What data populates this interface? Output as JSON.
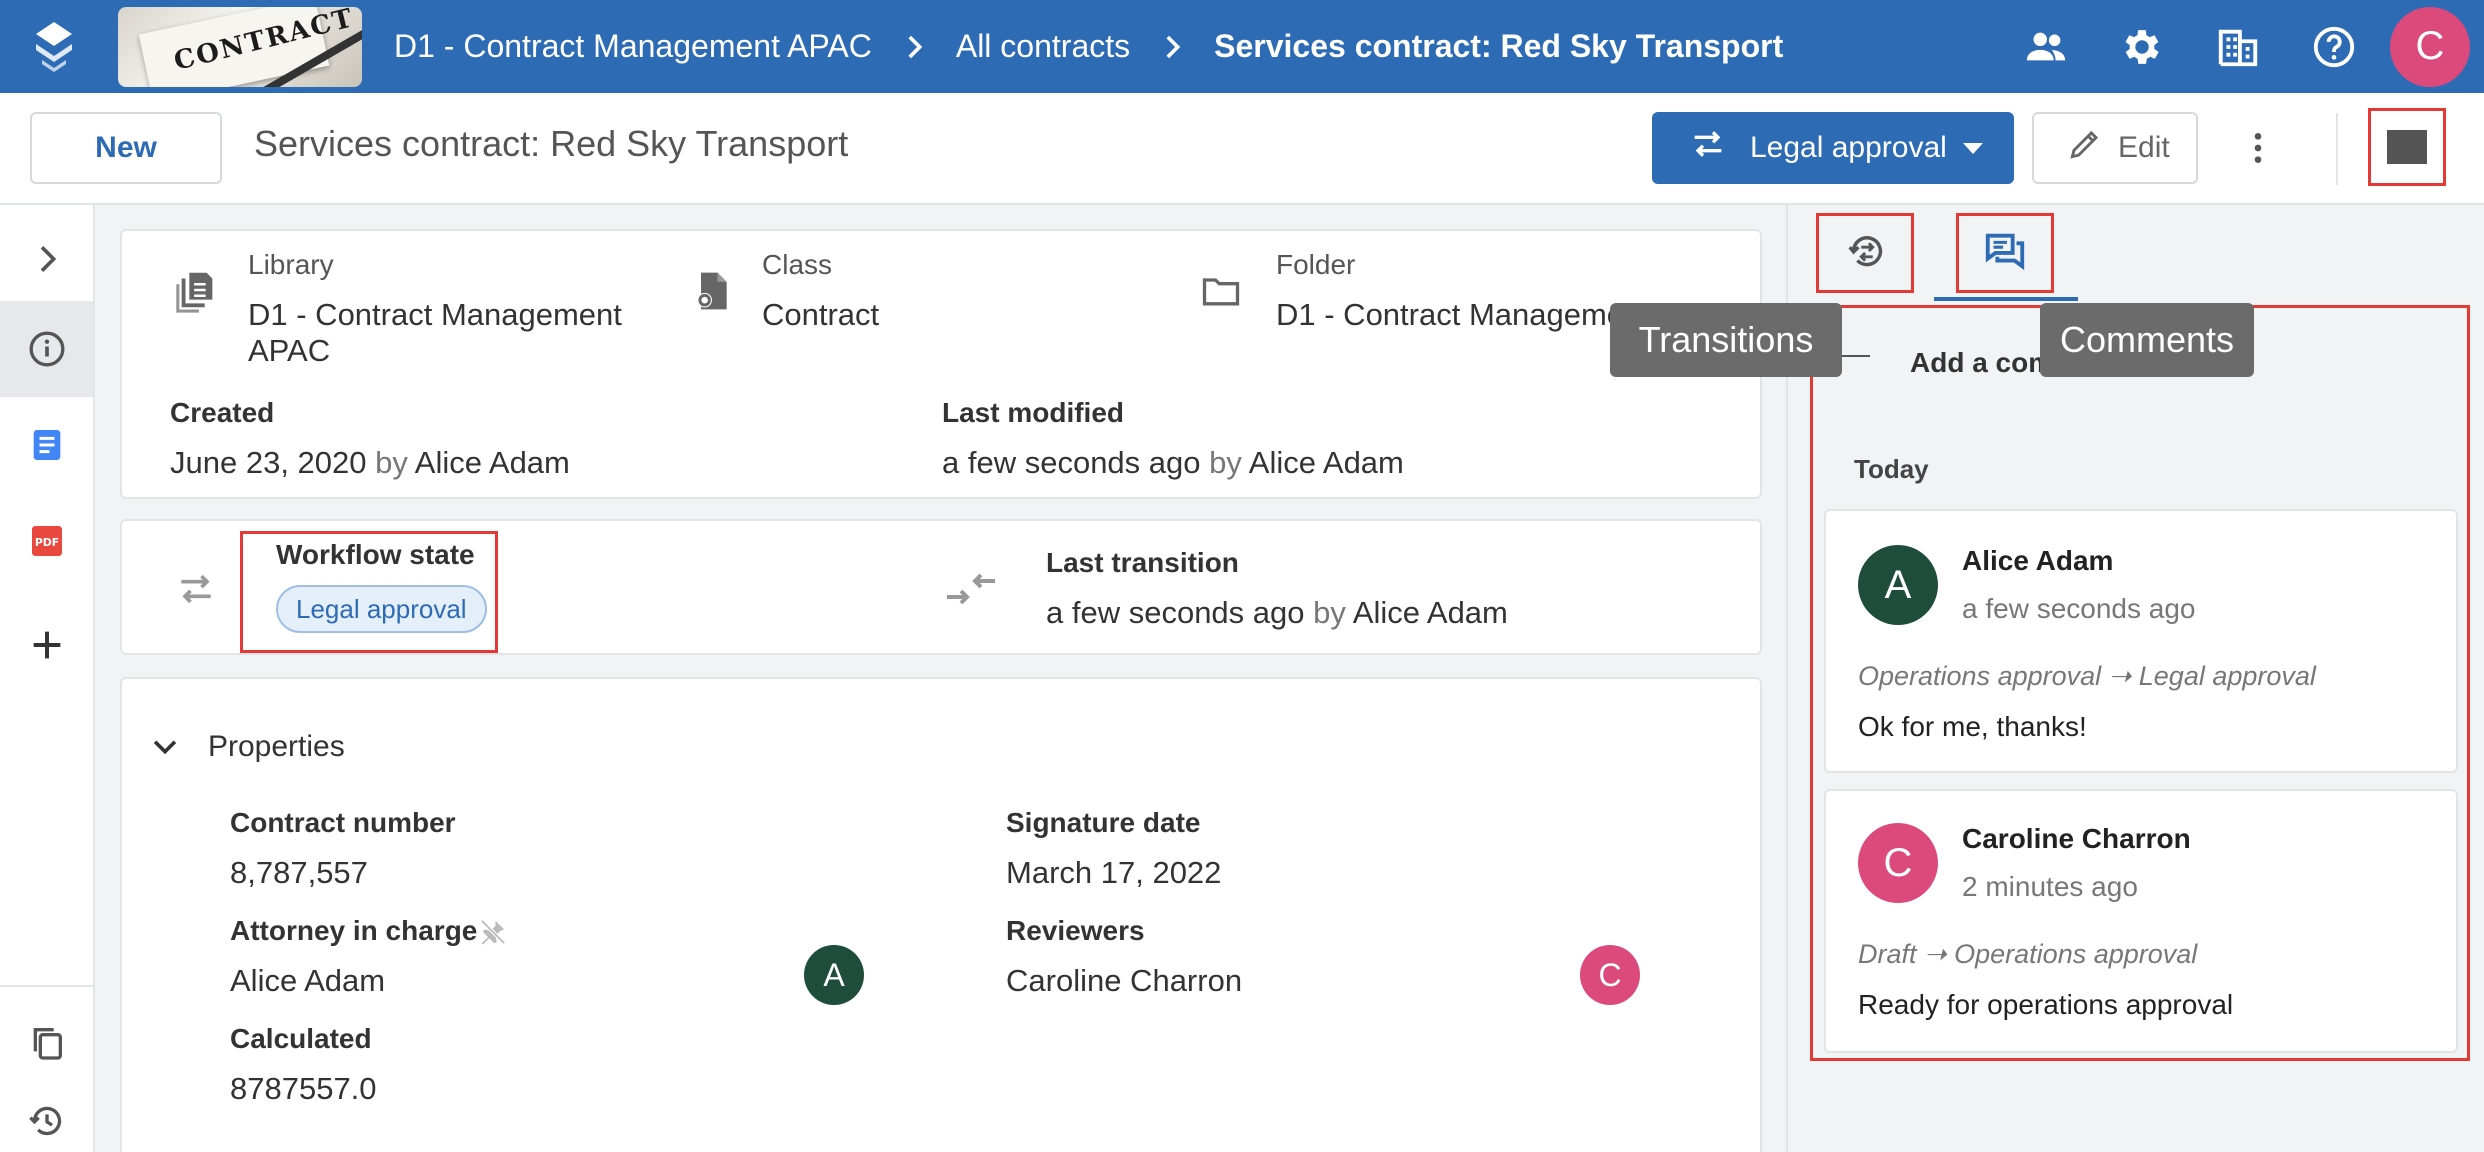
{
  "topbar": {
    "library_thumb_text": "CONTRACT",
    "breadcrumbs": [
      "D1 - Contract Management APAC",
      "All contracts",
      "Services contract: Red Sky Transport"
    ],
    "user_initial": "C"
  },
  "subbar": {
    "new_label": "New",
    "title": "Services contract: Red Sky Transport",
    "transition_label": "Legal approval",
    "edit_label": "Edit"
  },
  "info": {
    "library_label": "Library",
    "library_value_1": "D1 - Contract Management",
    "library_value_2": "APAC",
    "class_label": "Class",
    "class_value": "Contract",
    "folder_label": "Folder",
    "folder_value": "D1 - Contract Manageme",
    "created_label": "Created",
    "created_date": "June 23, 2020",
    "created_by_word": "by",
    "created_by": "Alice Adam",
    "modified_label": "Last modified",
    "modified_date": "a few seconds ago",
    "modified_by_word": "by",
    "modified_by": "Alice Adam"
  },
  "workflow": {
    "state_label": "Workflow state",
    "state_value": "Legal approval",
    "last_transition_label": "Last transition",
    "last_transition_date": "a few seconds ago",
    "last_transition_by_word": "by",
    "last_transition_by": "Alice Adam"
  },
  "properties": {
    "section_label": "Properties",
    "contract_number_label": "Contract number",
    "contract_number_value": "8,787,557",
    "signature_date_label": "Signature date",
    "signature_date_value": "March 17, 2022",
    "attorney_label": "Attorney in charge",
    "attorney_value": "Alice Adam",
    "attorney_initial": "A",
    "reviewers_label": "Reviewers",
    "reviewers_value": "Caroline Charron",
    "reviewers_initial": "C",
    "calculated_label": "Calculated",
    "calculated_value": "8787557.0"
  },
  "right_panel": {
    "tooltip_transitions": "Transitions",
    "tooltip_comments": "Comments",
    "add_comment_visible": "Add a com",
    "day_group": "Today",
    "comments": [
      {
        "initial": "A",
        "author": "Alice Adam",
        "when": "a few seconds ago",
        "transition": "Operations approval ➝ Legal approval",
        "text": "Ok for me, thanks!"
      },
      {
        "initial": "C",
        "author": "Caroline Charron",
        "when": "2 minutes ago",
        "transition": "Draft ➝ Operations approval",
        "text": "Ready for operations approval"
      }
    ]
  },
  "colors": {
    "brand_blue": "#2d6bb5",
    "avatar_green": "#1e4d3c",
    "avatar_pink": "#dc4a7b",
    "highlight_red": "#e53935"
  }
}
